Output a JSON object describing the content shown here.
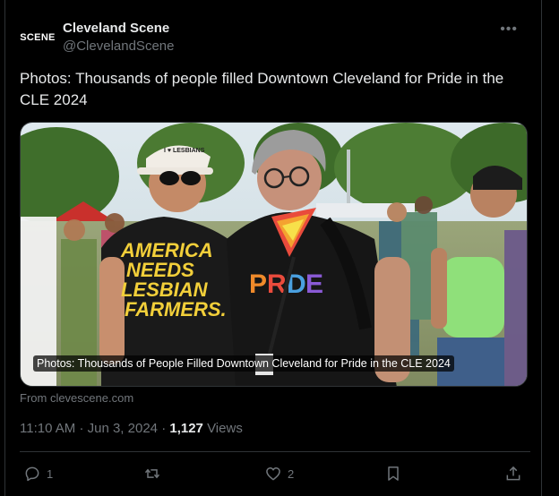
{
  "author": {
    "avatar_text": "SCENE",
    "display_name": "Cleveland Scene",
    "handle": "@ClevelandScene"
  },
  "more_icon": "more-horizontal-icon",
  "tweet_text": "Photos: Thousands of people filled Downtown Cleveland for Pride in the CLE 2024",
  "media": {
    "caption": "Photos: Thousands of People Filled Downtown Cleveland for Pride in the CLE 2024",
    "shirt_text_lines": [
      "AMERICA",
      "NEEDS",
      "LESBIAN",
      "FARMERS."
    ],
    "hat_text": "I ♥ LESBIANS"
  },
  "source": "From clevescene.com",
  "meta": {
    "time": "11:10 AM",
    "separator": "·",
    "date": "Jun 3, 2024",
    "views_count": "1,127",
    "views_label": "Views"
  },
  "actions": {
    "reply_count": "1",
    "retweet_count": "",
    "like_count": "2",
    "icons": [
      "reply-icon",
      "retweet-icon",
      "like-icon",
      "bookmark-icon",
      "share-icon"
    ]
  }
}
